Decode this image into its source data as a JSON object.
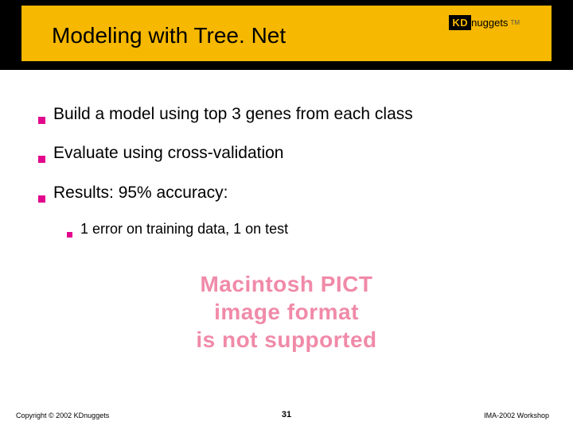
{
  "header": {
    "title": "Modeling with Tree. Net",
    "logo": {
      "box": "KD",
      "text": "nuggets",
      "tm": "TM"
    }
  },
  "bullets": [
    {
      "text": "Build a model using top 3 genes from each class"
    },
    {
      "text": "Evaluate using cross-validation"
    },
    {
      "text": "Results: 95% accuracy:"
    }
  ],
  "subbullets": [
    {
      "text": "1 error on training data, 1 on test"
    }
  ],
  "placeholder": {
    "line1": "Macintosh PICT",
    "line2": "image format",
    "line3": "is not supported"
  },
  "footer": {
    "left": "Copyright © 2002 KDnuggets",
    "center": "31",
    "right": "IMA-2002 Workshop"
  }
}
